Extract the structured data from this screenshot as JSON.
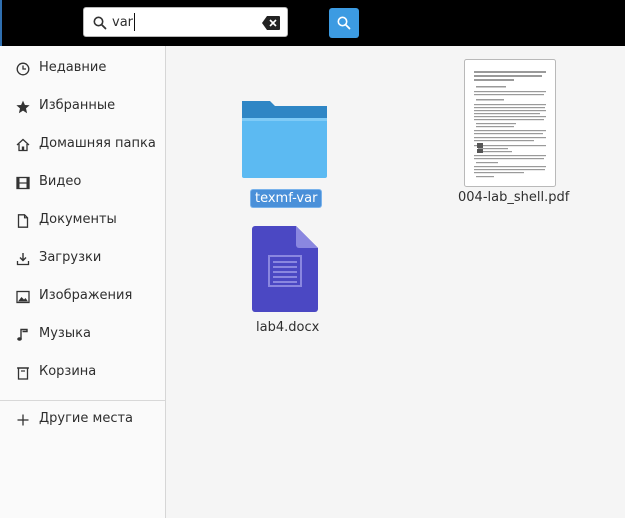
{
  "search": {
    "query": "var",
    "placeholder": ""
  },
  "sidebar": {
    "items": [
      {
        "label": "Недавние",
        "icon": "clock-icon"
      },
      {
        "label": "Избранные",
        "icon": "star-icon"
      },
      {
        "label": "Домашняя папка",
        "icon": "home-icon"
      },
      {
        "label": "Видео",
        "icon": "film-icon"
      },
      {
        "label": "Документы",
        "icon": "document-icon"
      },
      {
        "label": "Загрузки",
        "icon": "download-icon"
      },
      {
        "label": "Изображения",
        "icon": "image-icon"
      },
      {
        "label": "Музыка",
        "icon": "music-icon"
      },
      {
        "label": "Корзина",
        "icon": "trash-icon"
      }
    ],
    "other": {
      "label": "Другие места",
      "icon": "plus-icon"
    }
  },
  "files": [
    {
      "name": "texmf-var",
      "type": "folder",
      "selected": true
    },
    {
      "name": "004-lab_shell.pdf",
      "type": "pdf",
      "selected": false
    },
    {
      "name": "lab4.docx",
      "type": "docx",
      "selected": false
    }
  ],
  "colors": {
    "accent": "#3c9be2",
    "selection": "#4a90d9",
    "folder": "#5bb8f3",
    "docx": "#4a47c4"
  }
}
